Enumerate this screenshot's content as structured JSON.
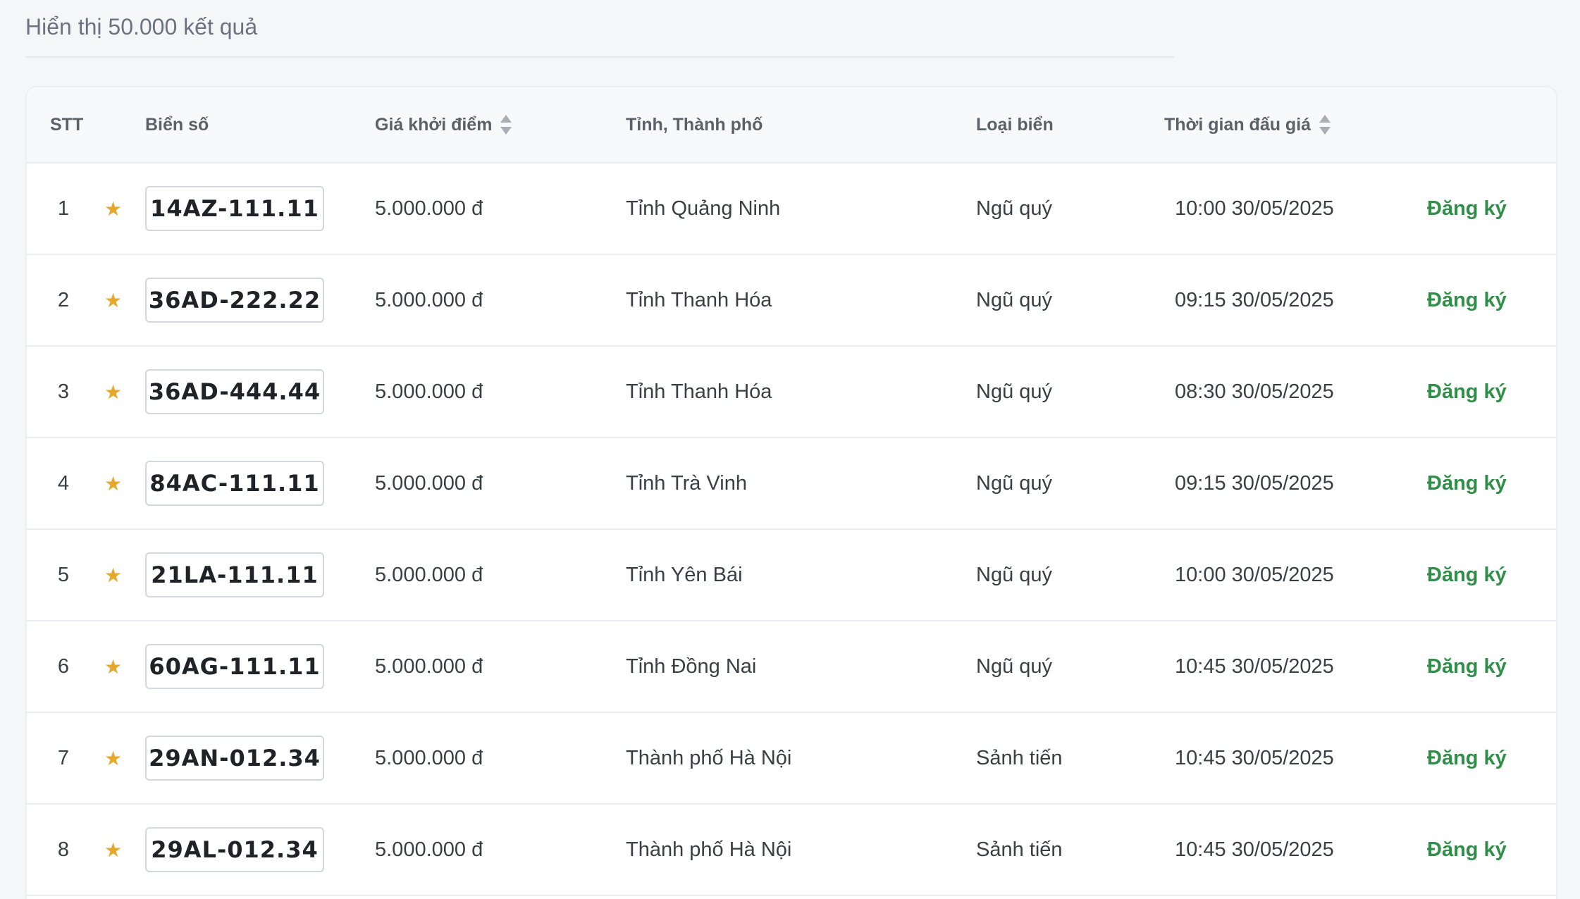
{
  "results": {
    "summary": "Hiển thị 50.000 kết quả"
  },
  "table": {
    "headers": {
      "stt": "STT",
      "plate": "Biển số",
      "price": "Giá khởi điểm",
      "province": "Tỉnh, Thành phố",
      "type": "Loại biển",
      "time": "Thời gian đấu giá"
    },
    "rows": [
      {
        "stt": "1",
        "plate": "14AZ-111.11",
        "price": "5.000.000 đ",
        "province": "Tỉnh Quảng Ninh",
        "type": "Ngũ quý",
        "time": "10:00 30/05/2025",
        "action": "Đăng ký"
      },
      {
        "stt": "2",
        "plate": "36AD-222.22",
        "price": "5.000.000 đ",
        "province": "Tỉnh Thanh Hóa",
        "type": "Ngũ quý",
        "time": "09:15 30/05/2025",
        "action": "Đăng ký"
      },
      {
        "stt": "3",
        "plate": "36AD-444.44",
        "price": "5.000.000 đ",
        "province": "Tỉnh Thanh Hóa",
        "type": "Ngũ quý",
        "time": "08:30 30/05/2025",
        "action": "Đăng ký"
      },
      {
        "stt": "4",
        "plate": "84AC-111.11",
        "price": "5.000.000 đ",
        "province": "Tỉnh Trà Vinh",
        "type": "Ngũ quý",
        "time": "09:15 30/05/2025",
        "action": "Đăng ký"
      },
      {
        "stt": "5",
        "plate": "21LA-111.11",
        "price": "5.000.000 đ",
        "province": "Tỉnh Yên Bái",
        "type": "Ngũ quý",
        "time": "10:00 30/05/2025",
        "action": "Đăng ký"
      },
      {
        "stt": "6",
        "plate": "60AG-111.11",
        "price": "5.000.000 đ",
        "province": "Tỉnh Đồng Nai",
        "type": "Ngũ quý",
        "time": "10:45 30/05/2025",
        "action": "Đăng ký"
      },
      {
        "stt": "7",
        "plate": "29AN-012.34",
        "price": "5.000.000 đ",
        "province": "Thành phố Hà Nội",
        "type": "Sảnh tiến",
        "time": "10:45 30/05/2025",
        "action": "Đăng ký"
      },
      {
        "stt": "8",
        "plate": "29AL-012.34",
        "price": "5.000.000 đ",
        "province": "Thành phố Hà Nội",
        "type": "Sảnh tiến",
        "time": "10:45 30/05/2025",
        "action": "Đăng ký"
      }
    ]
  },
  "icons": {
    "favorite": "star-icon",
    "sort": "sort-icon"
  },
  "colors": {
    "accent_green": "#2f8f48",
    "star": "#e6a82a",
    "background": "#f5f6f7"
  }
}
